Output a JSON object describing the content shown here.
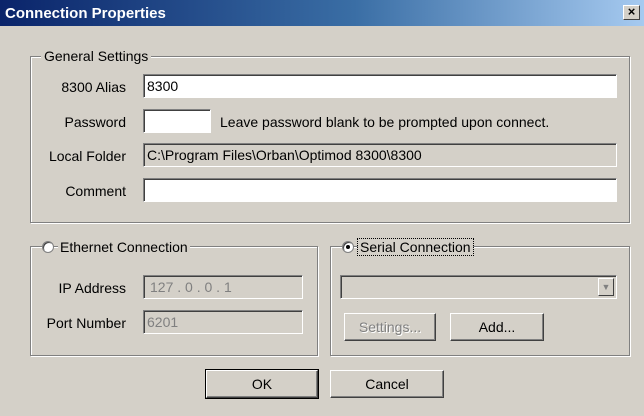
{
  "window": {
    "title": "Connection Properties",
    "close_label": "×"
  },
  "general": {
    "legend": "General Settings",
    "alias_label": "8300 Alias",
    "alias_value": "8300",
    "password_label": "Password",
    "password_value": "",
    "password_hint": "Leave password blank to be prompted upon connect.",
    "folder_label": "Local Folder",
    "folder_value": "C:\\Program Files\\Orban\\Optimod 8300\\8300",
    "comment_label": "Comment",
    "comment_value": ""
  },
  "ethernet": {
    "radio_label": "Ethernet Connection",
    "selected": false,
    "ip_label": "IP Address",
    "ip_value": "127 .  0  .  0  .  1",
    "port_label": "Port Number",
    "port_value": "6201"
  },
  "serial": {
    "radio_label": "Serial Connection",
    "selected": true,
    "port_value": "",
    "settings_label": "Settings...",
    "add_label": "Add..."
  },
  "actions": {
    "ok_label": "OK",
    "cancel_label": "Cancel"
  }
}
